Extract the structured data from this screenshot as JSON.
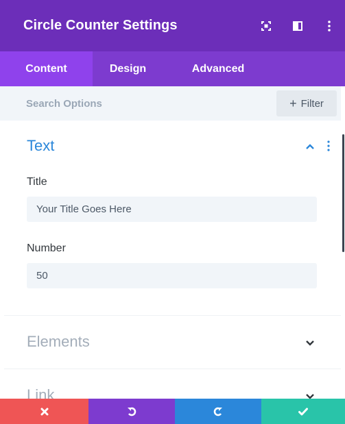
{
  "header": {
    "title": "Circle Counter Settings",
    "icons": [
      "fullscreen-icon",
      "split-view-icon",
      "more-options-icon"
    ]
  },
  "tabs": [
    {
      "label": "Content",
      "active": true
    },
    {
      "label": "Design",
      "active": false
    },
    {
      "label": "Advanced",
      "active": false
    }
  ],
  "search": {
    "placeholder": "Search Options",
    "value": "",
    "filter_label": "Filter"
  },
  "sections": {
    "text": {
      "title": "Text",
      "expanded": true,
      "fields": {
        "title": {
          "label": "Title",
          "placeholder": "Your Title Goes Here",
          "value": ""
        },
        "number": {
          "label": "Number",
          "value": "50"
        }
      }
    },
    "elements": {
      "title": "Elements",
      "expanded": false
    },
    "link": {
      "title": "Link",
      "expanded": false
    }
  },
  "footer": {
    "buttons": [
      "close-icon",
      "undo-icon",
      "redo-icon",
      "save-check-icon"
    ]
  },
  "colors": {
    "header_bg": "#6c2eb9",
    "tabs_bg": "#7d3bcf",
    "active_tab_bg": "#8f42ec",
    "section_title_active": "#2b87da",
    "footer_close": "#ef5555",
    "footer_undo": "#7d3bcf",
    "footer_redo": "#2b87da",
    "footer_save": "#29c4a9"
  }
}
